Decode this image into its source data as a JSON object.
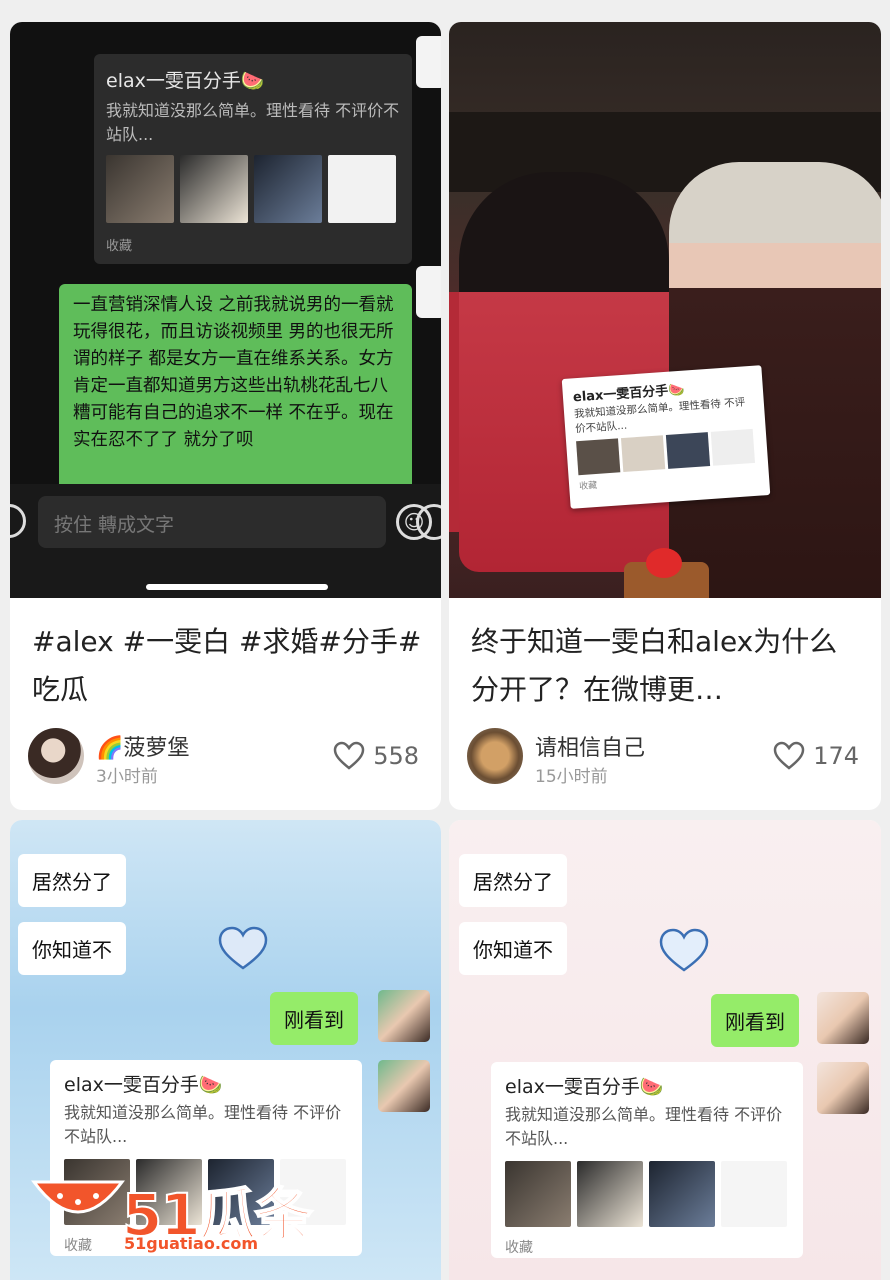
{
  "cards": [
    {
      "forward": {
        "title": "elax一雯百分手🍉",
        "text": "我就知道没那么简单。理性看待 不评价不站队...",
        "collect": "收藏"
      },
      "bubble": "一直营销深情人设 之前我就说男的一看就玩得很花，而且访谈视频里 男的也很无所谓的样子 都是女方一直在维系关系。女方肯定一直都知道男方这些出轨桃花乱七八糟可能有自己的追求不一样 不在乎。现在实在忍不了了 就分了呗",
      "input_placeholder": "按住 轉成文字",
      "title": "#alex #一雯白 #求婚#分手#吃瓜",
      "author": "🌈菠萝堡",
      "time": "3小时前",
      "likes": "558"
    },
    {
      "paper": {
        "title": "elax一雯百分手🍉",
        "text": "我就知道没那么简单。理性看待 不评价不站队...",
        "collect": "收藏"
      },
      "title": "终于知道一雯白和alex为什么分开了？在微博更…",
      "author": "请相信自己",
      "time": "15小时前",
      "likes": "174"
    },
    {
      "bubbles": [
        "居然分了",
        "你知道不"
      ],
      "reply": "刚看到",
      "forward": {
        "title": "elax一雯百分手🍉",
        "text": "我就知道没那么简单。理性看待 不评价不站队...",
        "collect": "收藏"
      }
    },
    {
      "bubbles": [
        "居然分了",
        "你知道不"
      ],
      "reply": "刚看到",
      "forward": {
        "title": "elax一雯百分手🍉",
        "text": "我就知道没那么简单。理性看待 不评价不站队...",
        "collect": "收藏"
      }
    }
  ],
  "watermark": {
    "main": "51瓜条",
    "url": "51guatiao.com"
  },
  "colors": {
    "wechat_green": "#95ec69",
    "dark_green": "#5fbd5a",
    "watermark": "#f2552b"
  }
}
